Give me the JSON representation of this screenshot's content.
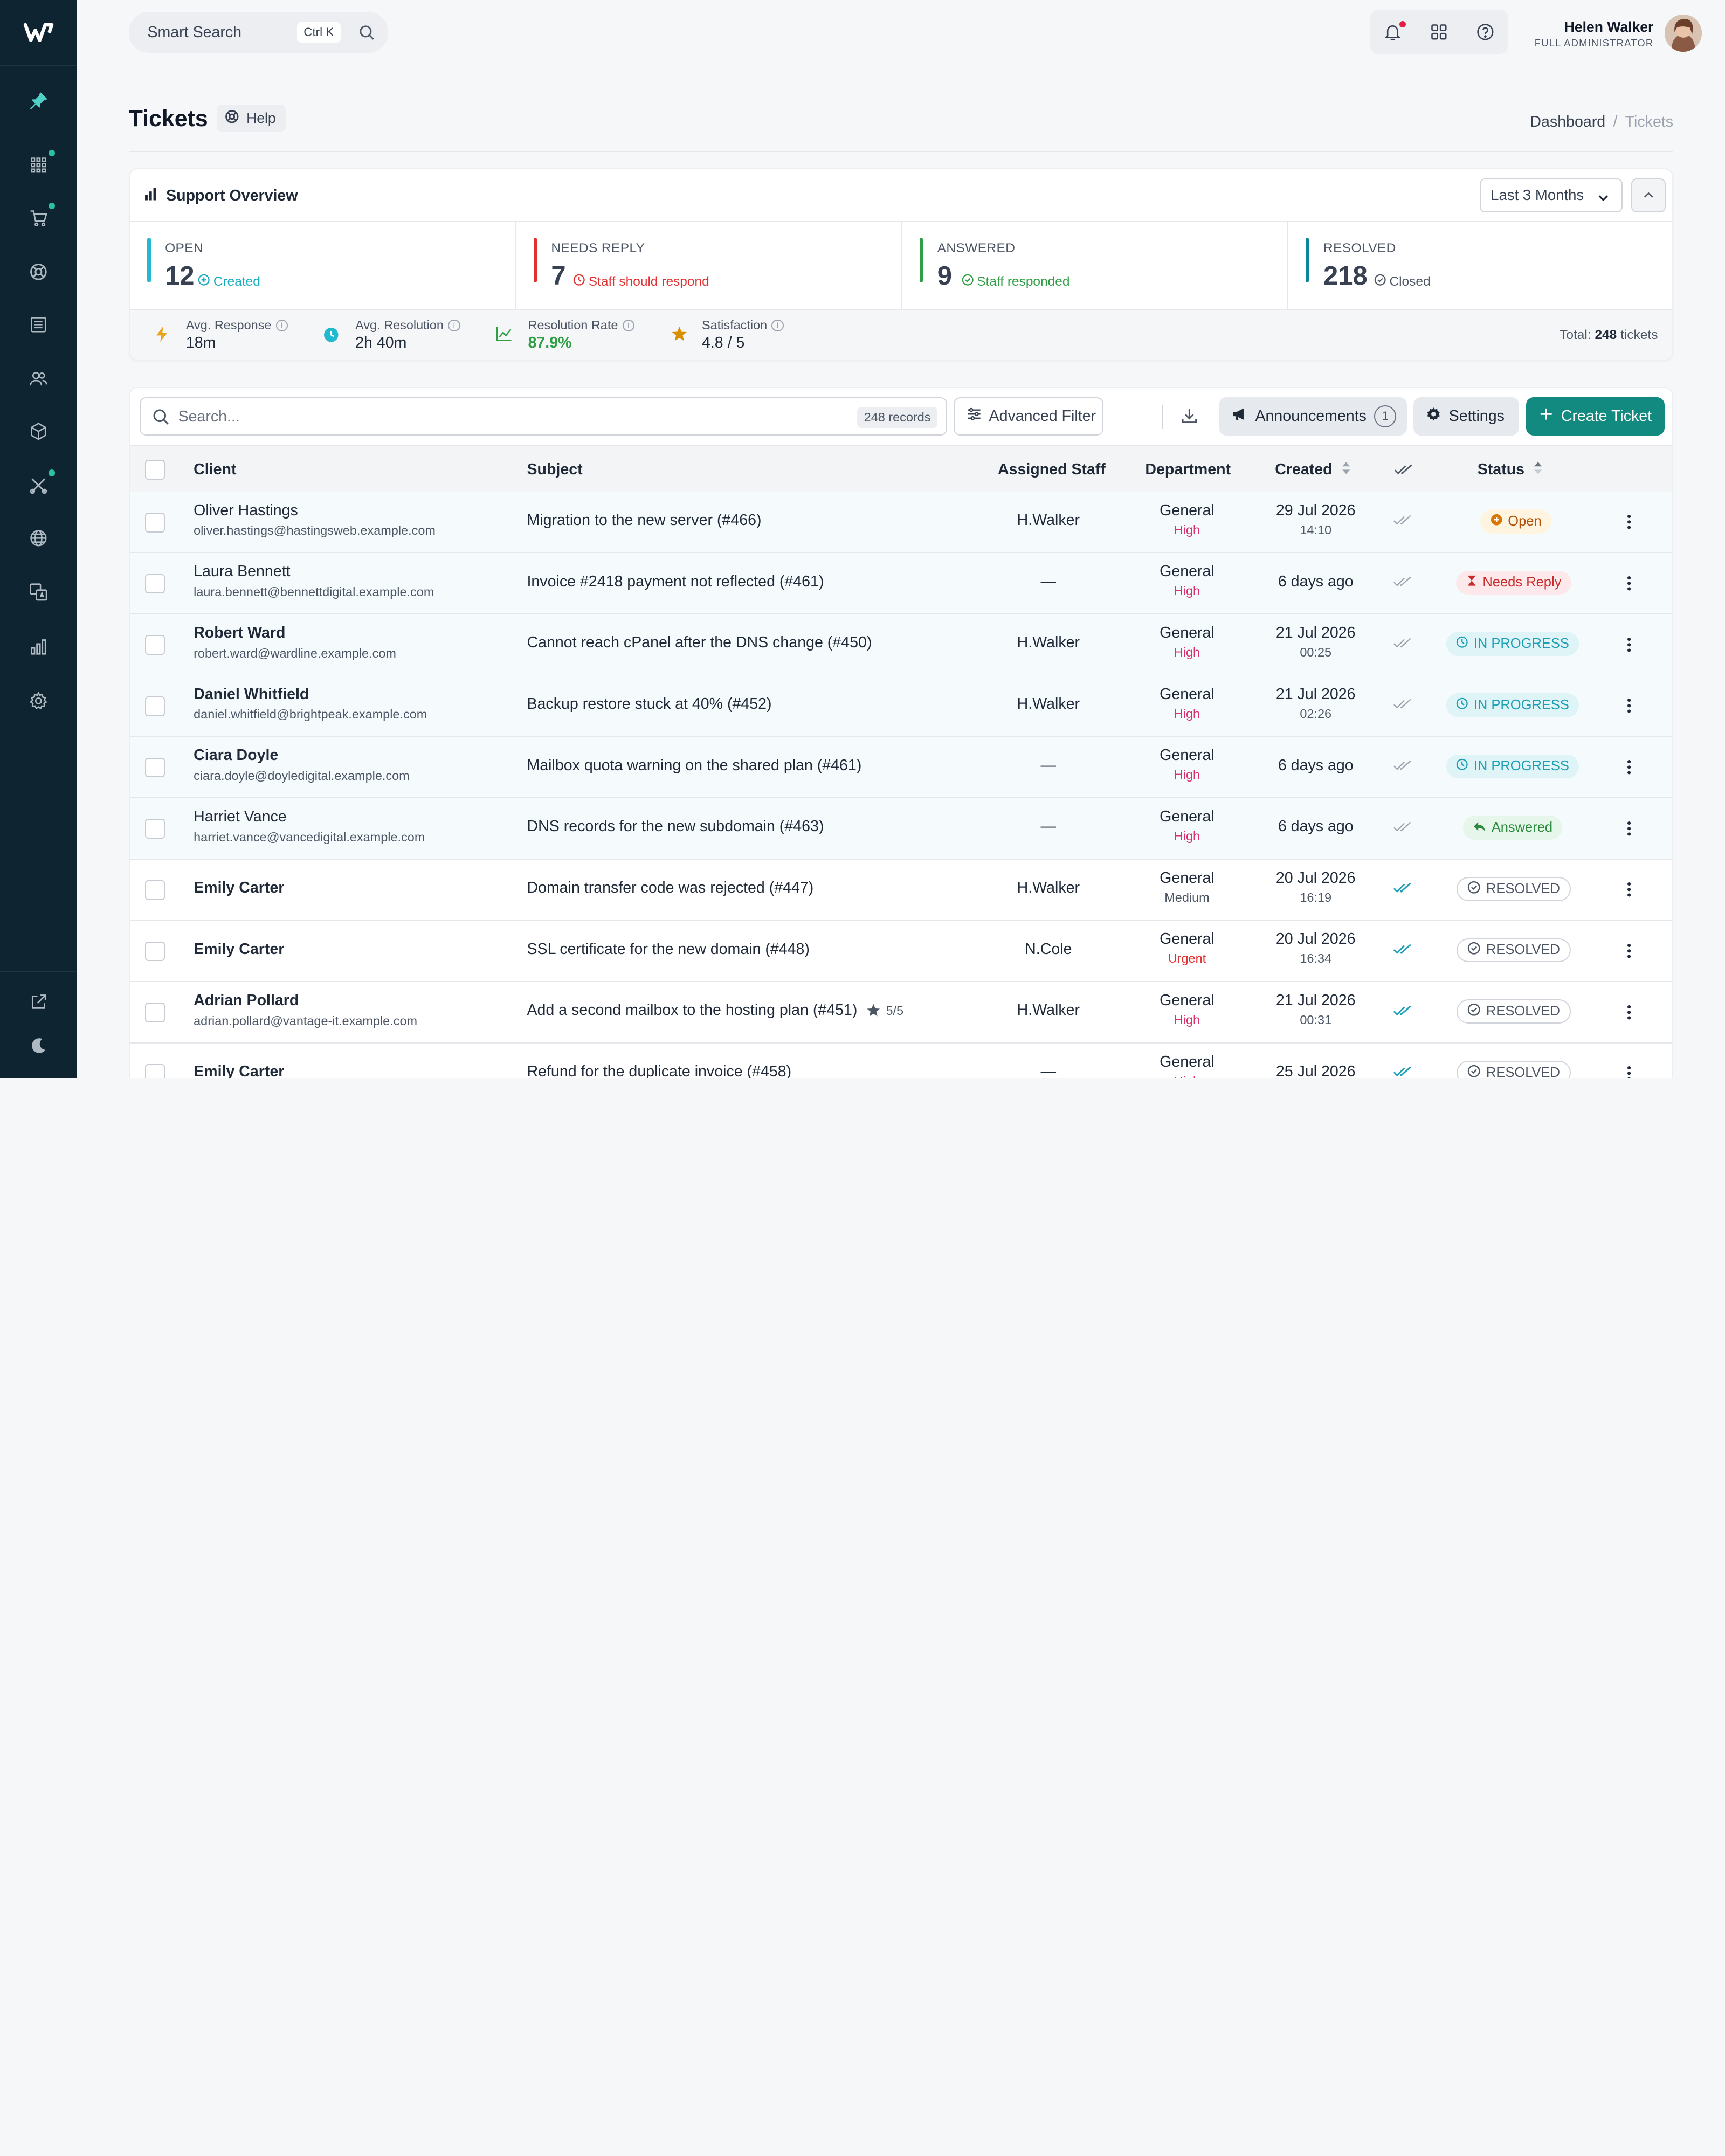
{
  "topbar": {
    "search_label": "Smart Search",
    "search_shortcut": "Ctrl K",
    "user_name": "Helen Walker",
    "user_role": "FULL ADMINISTRATOR"
  },
  "page": {
    "title": "Tickets",
    "help_label": "Help",
    "breadcrumb": [
      "Dashboard",
      "/",
      "Tickets"
    ]
  },
  "overview": {
    "title": "Support Overview",
    "range_select": "Last 3 Months",
    "stats": [
      {
        "label": "OPEN",
        "value": "12",
        "sub": "Created",
        "color": "#22b8cf"
      },
      {
        "label": "NEEDS REPLY",
        "value": "7",
        "sub": "Staff should respond",
        "color": "#e03131"
      },
      {
        "label": "ANSWERED",
        "value": "9",
        "sub": "Staff responded",
        "color": "#2f9e44"
      },
      {
        "label": "RESOLVED",
        "value": "218",
        "sub": "Closed",
        "color": "#0c8599"
      }
    ],
    "metrics": [
      {
        "label": "Avg. Response",
        "value": "18m"
      },
      {
        "label": "Avg. Resolution",
        "value": "2h 40m"
      },
      {
        "label": "Resolution Rate",
        "value": "87.9%"
      },
      {
        "label": "Satisfaction",
        "value": "4.8 / 5"
      }
    ],
    "total_prefix": "Total:",
    "total_value": "248",
    "total_suffix": "tickets"
  },
  "toolbar": {
    "search_placeholder": "Search...",
    "records": "248 records",
    "advanced_filter": "Advanced Filter",
    "announcements": "Announcements",
    "announcements_count": "1",
    "settings": "Settings",
    "create": "Create Ticket"
  },
  "table": {
    "headers": {
      "client": "Client",
      "subject": "Subject",
      "staff": "Assigned Staff",
      "department": "Department",
      "created": "Created",
      "status": "Status"
    },
    "rows": [
      {
        "name": "Oliver Hastings",
        "email": "oliver.hastings@hastingsweb.example.com",
        "subject": "Migration to the new server (#466)",
        "rating": "",
        "staff": "H.Walker",
        "dept": "General",
        "priority": "High",
        "date": "29 Jul 2026",
        "time": "14:10",
        "status": "Open",
        "tint": true,
        "bold": false
      },
      {
        "name": "Laura Bennett",
        "email": "laura.bennett@bennettdigital.example.com",
        "subject": "Invoice #2418 payment not reflected (#461)",
        "rating": "",
        "staff": "—",
        "dept": "General",
        "priority": "High",
        "date": "6 days ago",
        "time": "",
        "status": "Needs Reply",
        "tint": true,
        "bold": false
      },
      {
        "name": "Robert Ward",
        "email": "robert.ward@wardline.example.com",
        "subject": "Cannot reach cPanel after the DNS change (#450)",
        "rating": "",
        "staff": "H.Walker",
        "dept": "General",
        "priority": "High",
        "date": "21 Jul 2026",
        "time": "00:25",
        "status": "IN PROGRESS",
        "tint": true,
        "bold": true
      },
      {
        "name": "Daniel Whitfield",
        "email": "daniel.whitfield@brightpeak.example.com",
        "subject": "Backup restore stuck at 40% (#452)",
        "rating": "",
        "staff": "H.Walker",
        "dept": "General",
        "priority": "High",
        "date": "21 Jul 2026",
        "time": "02:26",
        "status": "IN PROGRESS",
        "tint": true,
        "bold": true
      },
      {
        "name": "Ciara Doyle",
        "email": "ciara.doyle@doyledigital.example.com",
        "subject": "Mailbox quota warning on the shared plan (#461)",
        "rating": "",
        "staff": "—",
        "dept": "General",
        "priority": "High",
        "date": "6 days ago",
        "time": "",
        "status": "IN PROGRESS",
        "tint": true,
        "bold": true
      },
      {
        "name": "Harriet Vance",
        "email": "harriet.vance@vancedigital.example.com",
        "subject": "DNS records for the new subdomain (#463)",
        "rating": "",
        "staff": "—",
        "dept": "General",
        "priority": "High",
        "date": "6 days ago",
        "time": "",
        "status": "Answered",
        "tint": true,
        "bold": false
      },
      {
        "name": "Emily Carter",
        "email": "",
        "subject": "Domain transfer code was rejected (#447)",
        "rating": "",
        "staff": "H.Walker",
        "dept": "General",
        "priority": "Medium",
        "date": "20 Jul 2026",
        "time": "16:19",
        "status": "RESOLVED",
        "tint": false,
        "bold": true
      },
      {
        "name": "Emily Carter",
        "email": "",
        "subject": "SSL certificate for the new domain (#448)",
        "rating": "",
        "staff": "N.Cole",
        "dept": "General",
        "priority": "Urgent",
        "date": "20 Jul 2026",
        "time": "16:34",
        "status": "RESOLVED",
        "tint": false,
        "bold": true
      },
      {
        "name": "Adrian Pollard",
        "email": "adrian.pollard@vantage-it.example.com",
        "subject": "Add a second mailbox to the hosting plan (#451)",
        "rating": "5/5",
        "staff": "H.Walker",
        "dept": "General",
        "priority": "High",
        "date": "21 Jul 2026",
        "time": "00:31",
        "status": "RESOLVED",
        "tint": false,
        "bold": true
      },
      {
        "name": "Emily Carter",
        "email": "",
        "subject": "Refund for the duplicate invoice (#458)",
        "rating": "",
        "staff": "—",
        "dept": "General",
        "priority": "High",
        "date": "25 Jul 2026",
        "time": "",
        "status": "RESOLVED",
        "tint": false,
        "bold": true
      }
    ]
  },
  "colors": {
    "sidebar_bg": "#0f2431",
    "accent": "#138a7f",
    "priority_red": "#d6336c"
  }
}
